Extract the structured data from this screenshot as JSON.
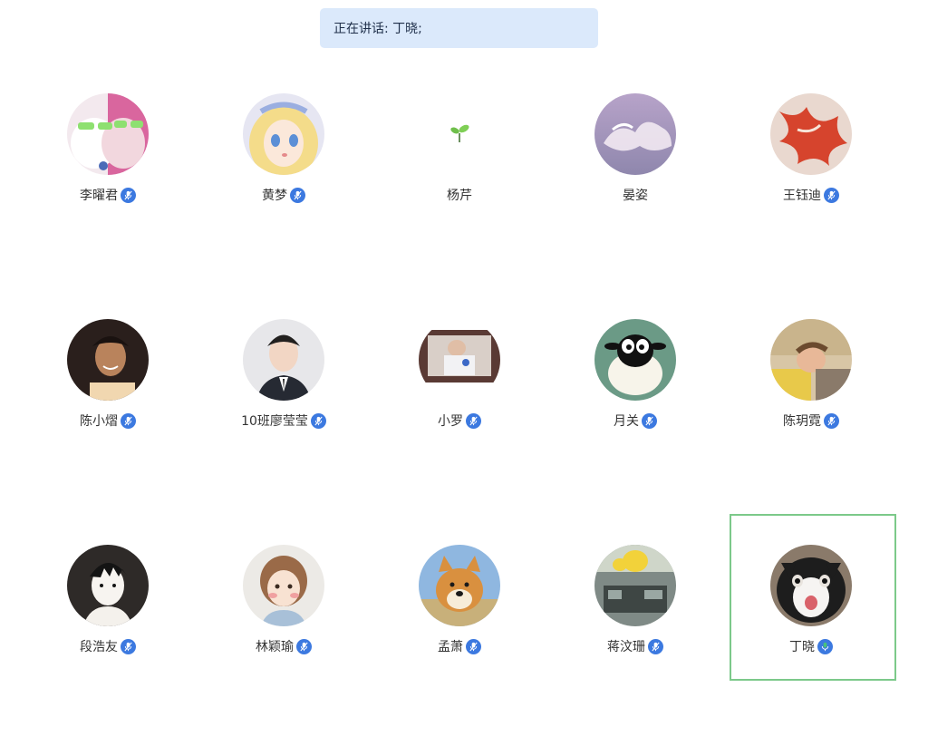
{
  "banner": {
    "label": "正在讲话: 丁晓;"
  },
  "colors": {
    "accent": "#3c79e0",
    "speaking_border": "#7cc98a",
    "banner_bg": "#dbe9fb"
  },
  "participants": [
    {
      "name": "李曜君",
      "mic": "muted",
      "avatar": "cats-with-green-glasses"
    },
    {
      "name": "黄梦",
      "mic": "muted",
      "avatar": "anime-girl-blonde"
    },
    {
      "name": "杨芹",
      "mic": "none",
      "avatar": "sprout-icon"
    },
    {
      "name": "晏姿",
      "mic": "none",
      "avatar": "cloud-sky"
    },
    {
      "name": "王钰迪",
      "mic": "muted",
      "avatar": "red-abstract"
    },
    {
      "name": "陈小熠",
      "mic": "muted",
      "avatar": "smiling-man-dark"
    },
    {
      "name": "10班廖莹莹",
      "mic": "muted",
      "avatar": "man-in-suit"
    },
    {
      "name": "小罗",
      "mic": "muted",
      "avatar": "person-in-window"
    },
    {
      "name": "月关",
      "mic": "muted",
      "avatar": "cartoon-sheep"
    },
    {
      "name": "陈玥霓",
      "mic": "muted",
      "avatar": "girl-lying-down"
    },
    {
      "name": "段浩友",
      "mic": "muted",
      "avatar": "anime-boy-sketch"
    },
    {
      "name": "林颖瑜",
      "mic": "muted",
      "avatar": "cartoon-girl-blush"
    },
    {
      "name": "孟萧",
      "mic": "muted",
      "avatar": "shiba-dog"
    },
    {
      "name": "蒋汶珊",
      "mic": "muted",
      "avatar": "street-scene-duck"
    },
    {
      "name": "丁晓",
      "mic": "on",
      "speaking": true,
      "avatar": "surprised-cat"
    }
  ]
}
